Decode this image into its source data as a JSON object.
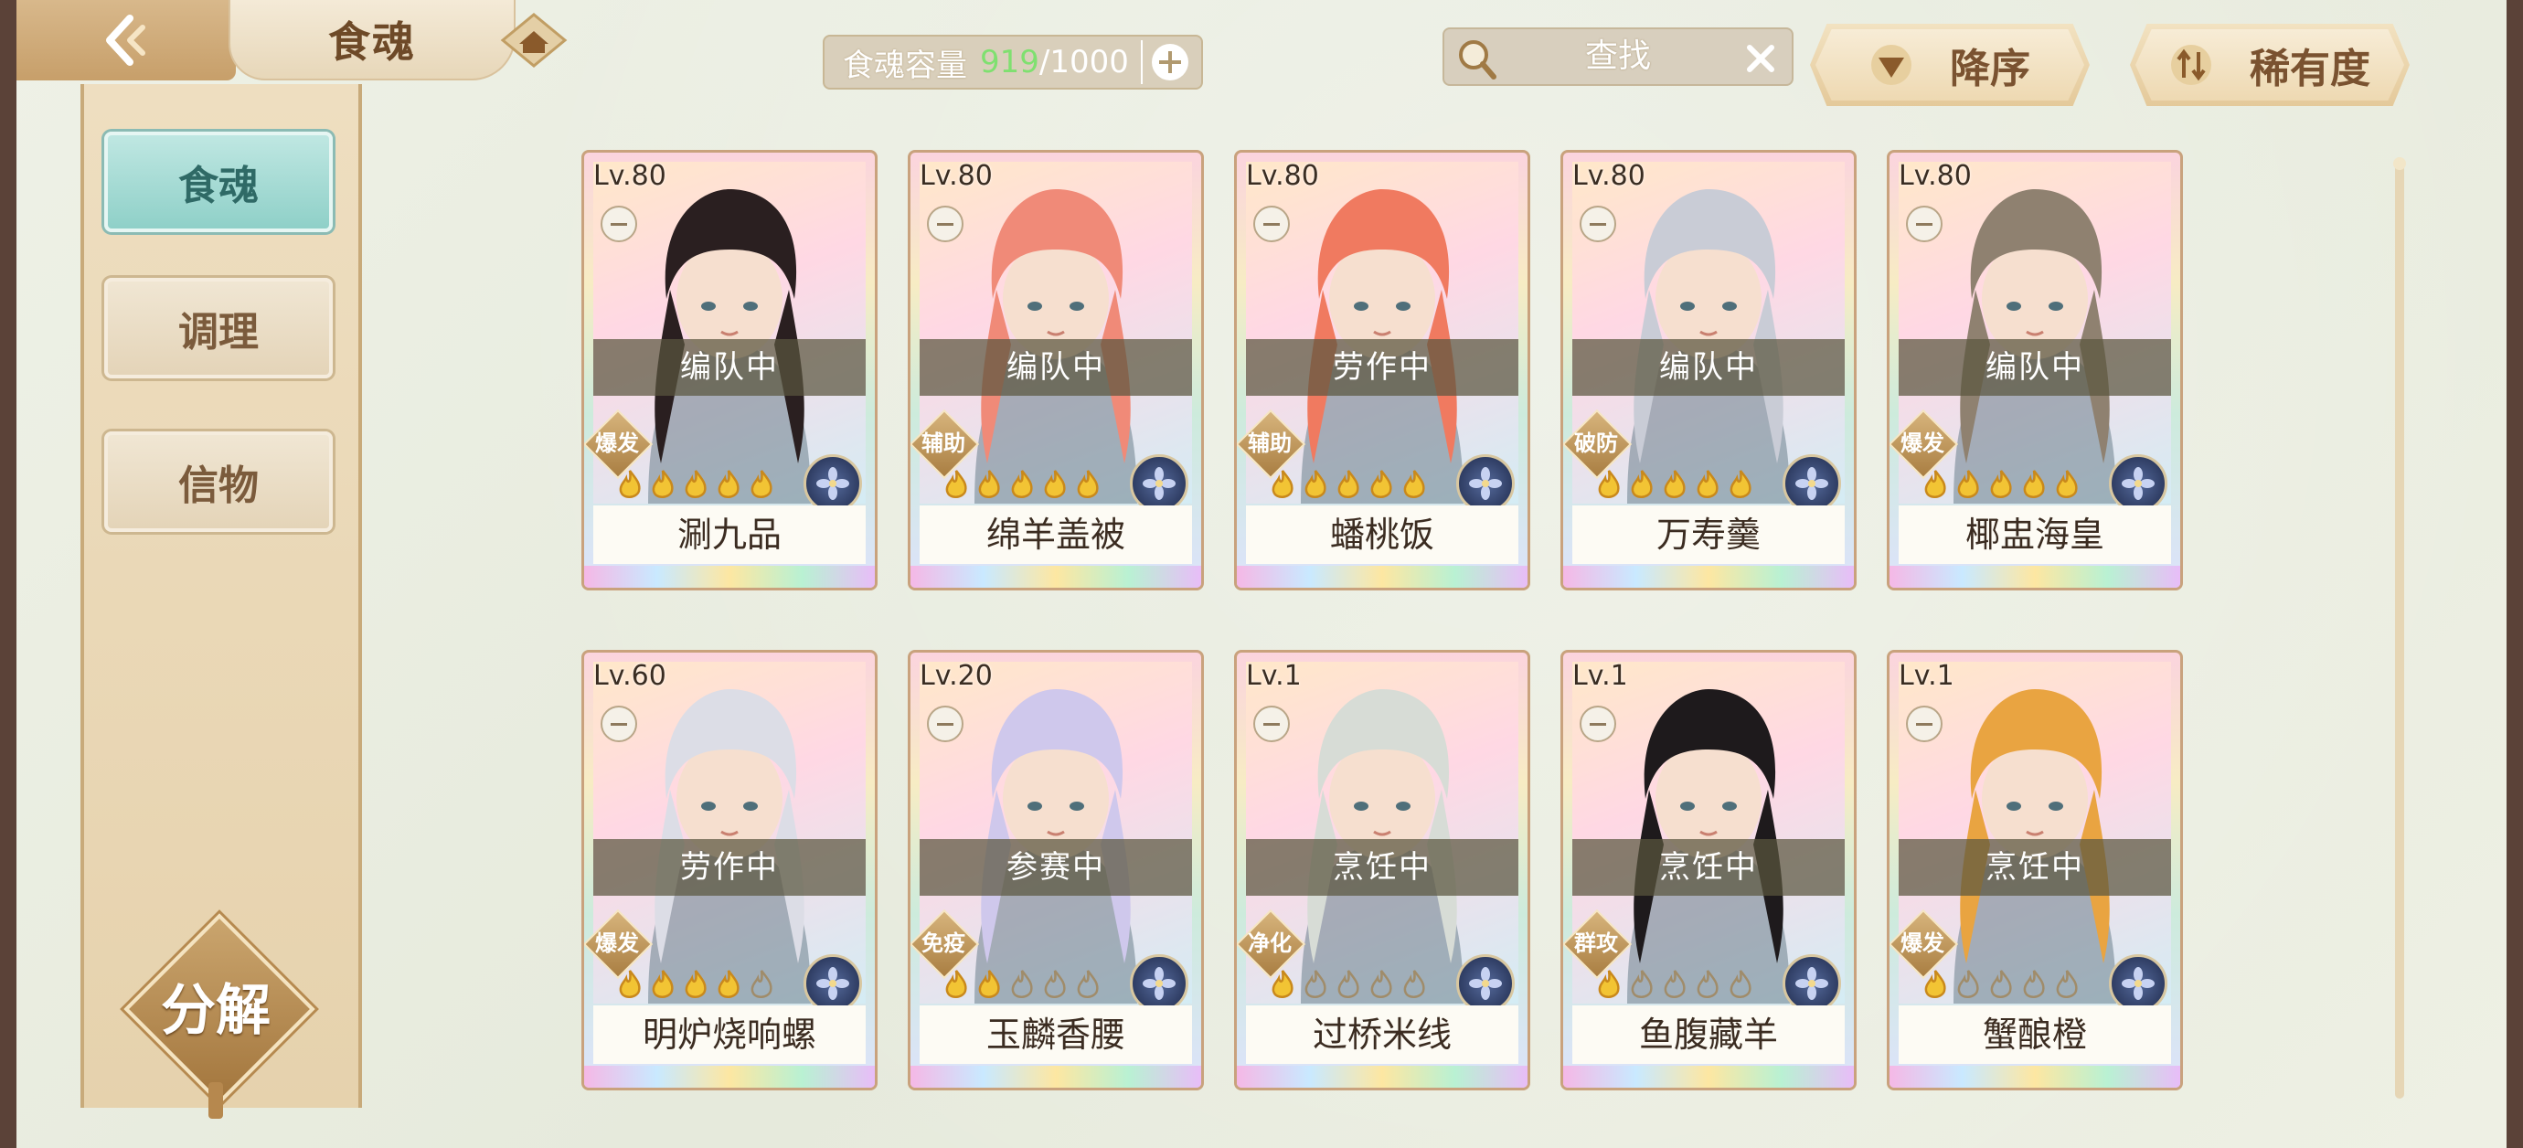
{
  "header": {
    "title": "食魂",
    "capacity_label": "食魂容量",
    "capacity_current": "919",
    "capacity_separator": "/",
    "capacity_max": "1000",
    "search_placeholder": "查找",
    "sort_order_label": "降序",
    "sort_key_label": "稀有度"
  },
  "sidebar": {
    "items": [
      {
        "label": "食魂",
        "active": true
      },
      {
        "label": "调理",
        "active": false
      },
      {
        "label": "信物",
        "active": false
      }
    ],
    "decompose_label": "分解"
  },
  "cards": [
    {
      "level": "Lv.80",
      "status": "编队中",
      "role": "爆发",
      "name": "涮九品",
      "stars": 5,
      "hair": "#2a1f20"
    },
    {
      "level": "Lv.80",
      "status": "编队中",
      "role": "辅助",
      "name": "绵羊盖被",
      "stars": 5,
      "hair": "#f08a78"
    },
    {
      "level": "Lv.80",
      "status": "劳作中",
      "role": "辅助",
      "name": "蟠桃饭",
      "stars": 5,
      "hair": "#f07a60"
    },
    {
      "level": "Lv.80",
      "status": "编队中",
      "role": "破防",
      "name": "万寿羹",
      "stars": 5,
      "hair": "#c9ccd6"
    },
    {
      "level": "Lv.80",
      "status": "编队中",
      "role": "爆发",
      "name": "椰盅海皇",
      "stars": 5,
      "hair": "#8f8170"
    },
    {
      "level": "Lv.60",
      "status": "劳作中",
      "role": "爆发",
      "name": "明炉烧响螺",
      "stars": 4,
      "hair": "#dcdde6"
    },
    {
      "level": "Lv.20",
      "status": "参赛中",
      "role": "免疫",
      "name": "玉麟香腰",
      "stars": 2,
      "hair": "#cfc8ec"
    },
    {
      "level": "Lv.1",
      "status": "烹饪中",
      "role": "净化",
      "name": "过桥米线",
      "stars": 1,
      "hair": "#d7dcd6"
    },
    {
      "level": "Lv.1",
      "status": "烹饪中",
      "role": "群攻",
      "name": "鱼腹藏羊",
      "stars": 1,
      "hair": "#1e1a1c"
    },
    {
      "level": "Lv.1",
      "status": "烹饪中",
      "role": "爆发",
      "name": "蟹酿橙",
      "stars": 1,
      "hair": "#e9a441"
    }
  ],
  "colors": {
    "accent_teal": "#8fd0c8",
    "gold": "#c79f6a",
    "capacity_green": "#7fe070"
  },
  "icons": [
    "back-arrow-icon",
    "home-icon",
    "plus-icon",
    "search-icon",
    "close-icon",
    "sort-desc-icon",
    "sort-swap-icon",
    "flame-icon",
    "emblem-icon"
  ]
}
